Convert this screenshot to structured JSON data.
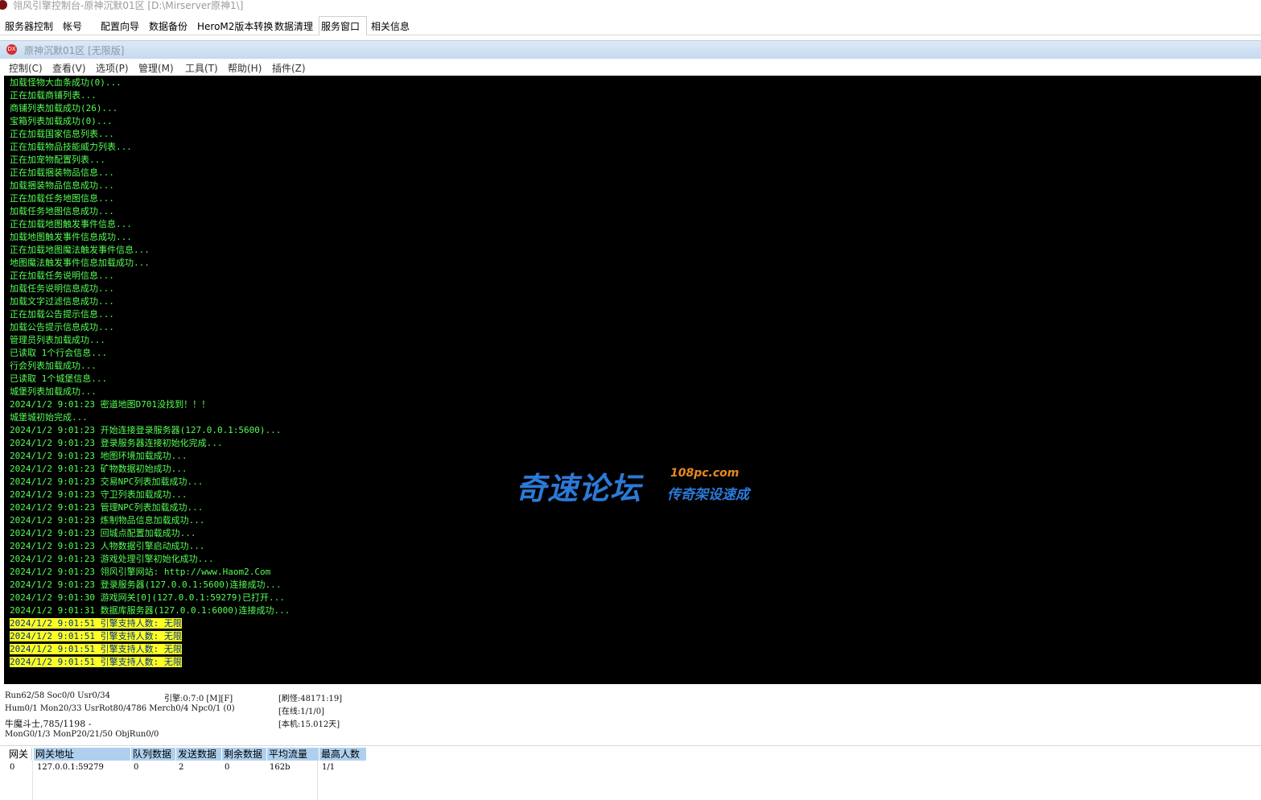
{
  "window": {
    "title": "翎风引擎控制台-原神沉默01区 [D:\\Mirserver原神1\\]"
  },
  "tabs": [
    {
      "label": "服务器控制",
      "active": false
    },
    {
      "label": "帐号",
      "active": false
    },
    {
      "label": "配置向导",
      "active": false
    },
    {
      "label": "数据备份",
      "active": false
    },
    {
      "label": "HeroM2版本转换",
      "active": false
    },
    {
      "label": "数据清理",
      "active": false
    },
    {
      "label": "服务窗口",
      "active": true
    },
    {
      "label": "相关信息",
      "active": false
    }
  ],
  "inner_window": {
    "icon_text": "DX",
    "title": "原神沉默01区 [无限版]"
  },
  "menu": [
    "控制(C)",
    "查看(V)",
    "选项(P)",
    "管理(M)",
    "工具(T)",
    "帮助(H)",
    "插件(Z)"
  ],
  "log": [
    "加载怪物大血条成功(0)...",
    "正在加载商铺列表...",
    "商铺列表加载成功(26)...",
    "宝箱列表加载成功(0)...",
    "正在加载国家信息列表...",
    "正在加载物品技能威力列表...",
    "正在加宠物配置列表...",
    "正在加载捆装物品信息...",
    "加载捆装物品信息成功...",
    "正在加载任务地图信息...",
    "加载任务地图信息成功...",
    "正在加载地图触发事件信息...",
    "加载地图触发事件信息成功...",
    "正在加载地图魔法触发事件信息...",
    "地图魔法触发事件信息加载成功...",
    "正在加载任务说明信息...",
    "加载任务说明信息成功...",
    "加载文字过滤信息成功...",
    "正在加载公告提示信息...",
    "加载公告提示信息成功...",
    "管理员列表加载成功...",
    "已读取 1个行会信息...",
    "行会列表加载成功...",
    "已读取 1个城堡信息...",
    "城堡列表加载成功...",
    "2024/1/2 9:01:23 密道地图D701没找到！！！",
    "城堡城初始完成...",
    "2024/1/2 9:01:23 开始连接登录服务器(127.0.0.1:5600)...",
    "2024/1/2 9:01:23 登录服务器连接初始化完成...",
    "2024/1/2 9:01:23 地图环境加载成功...",
    "2024/1/2 9:01:23 矿物数据初始成功...",
    "2024/1/2 9:01:23 交易NPC列表加载成功...",
    "2024/1/2 9:01:23 守卫列表加载成功...",
    "2024/1/2 9:01:23 管理NPC列表加载成功...",
    "2024/1/2 9:01:23 炼制物品信息加载成功...",
    "2024/1/2 9:01:23 回城点配置加载成功...",
    "2024/1/2 9:01:23 人物数据引擎启动成功...",
    "2024/1/2 9:01:23 游戏处理引擎初始化成功...",
    "2024/1/2 9:01:23 翎风引擎网站: http://www.Haom2.Com",
    "2024/1/2 9:01:23 登录服务器(127.0.0.1:5600)连接成功...",
    "2024/1/2 9:01:30 游戏网关[0](127.0.0.1:59279)已打开...",
    "2024/1/2 9:01:31 数据库服务器(127.0.0.1:6000)连接成功..."
  ],
  "log_highlight": [
    "2024/1/2 9:01:51 引擎支持人数: 无限",
    "2024/1/2 9:01:51 引擎支持人数: 无限",
    "2024/1/2 9:01:51 引擎支持人数: 无限",
    "2024/1/2 9:01:51 引擎支持人数: 无限"
  ],
  "watermark": {
    "main": "奇速论坛",
    "site": "108pc.com",
    "sub": "传奇架设速成"
  },
  "status": {
    "run": "Run62/58 Soc0/0 Usr0/34",
    "engine": "引擎:0:7:0 [M][F]",
    "refresh": "[刷怪:48171:19]",
    "hum": "Hum0/1 Mon20/33 UsrRot80/4786 Merch0/4 Npc0/1 (0)",
    "online": "[在线:1/1/0]",
    "monster": "牛魔斗士,785/1198 -",
    "local": "[本机:15.012天]",
    "mongo": "MonG0/1/3 MonP20/21/50 ObjRun0/0"
  },
  "gateway_table": {
    "columns": [
      "网关",
      "网关地址",
      "队列数据",
      "发送数据",
      "剩余数据",
      "平均流量",
      "最高人数"
    ],
    "rows": [
      [
        "0",
        "127.0.0.1:59279",
        "0",
        "2",
        "0",
        "162b",
        "1/1"
      ]
    ]
  }
}
